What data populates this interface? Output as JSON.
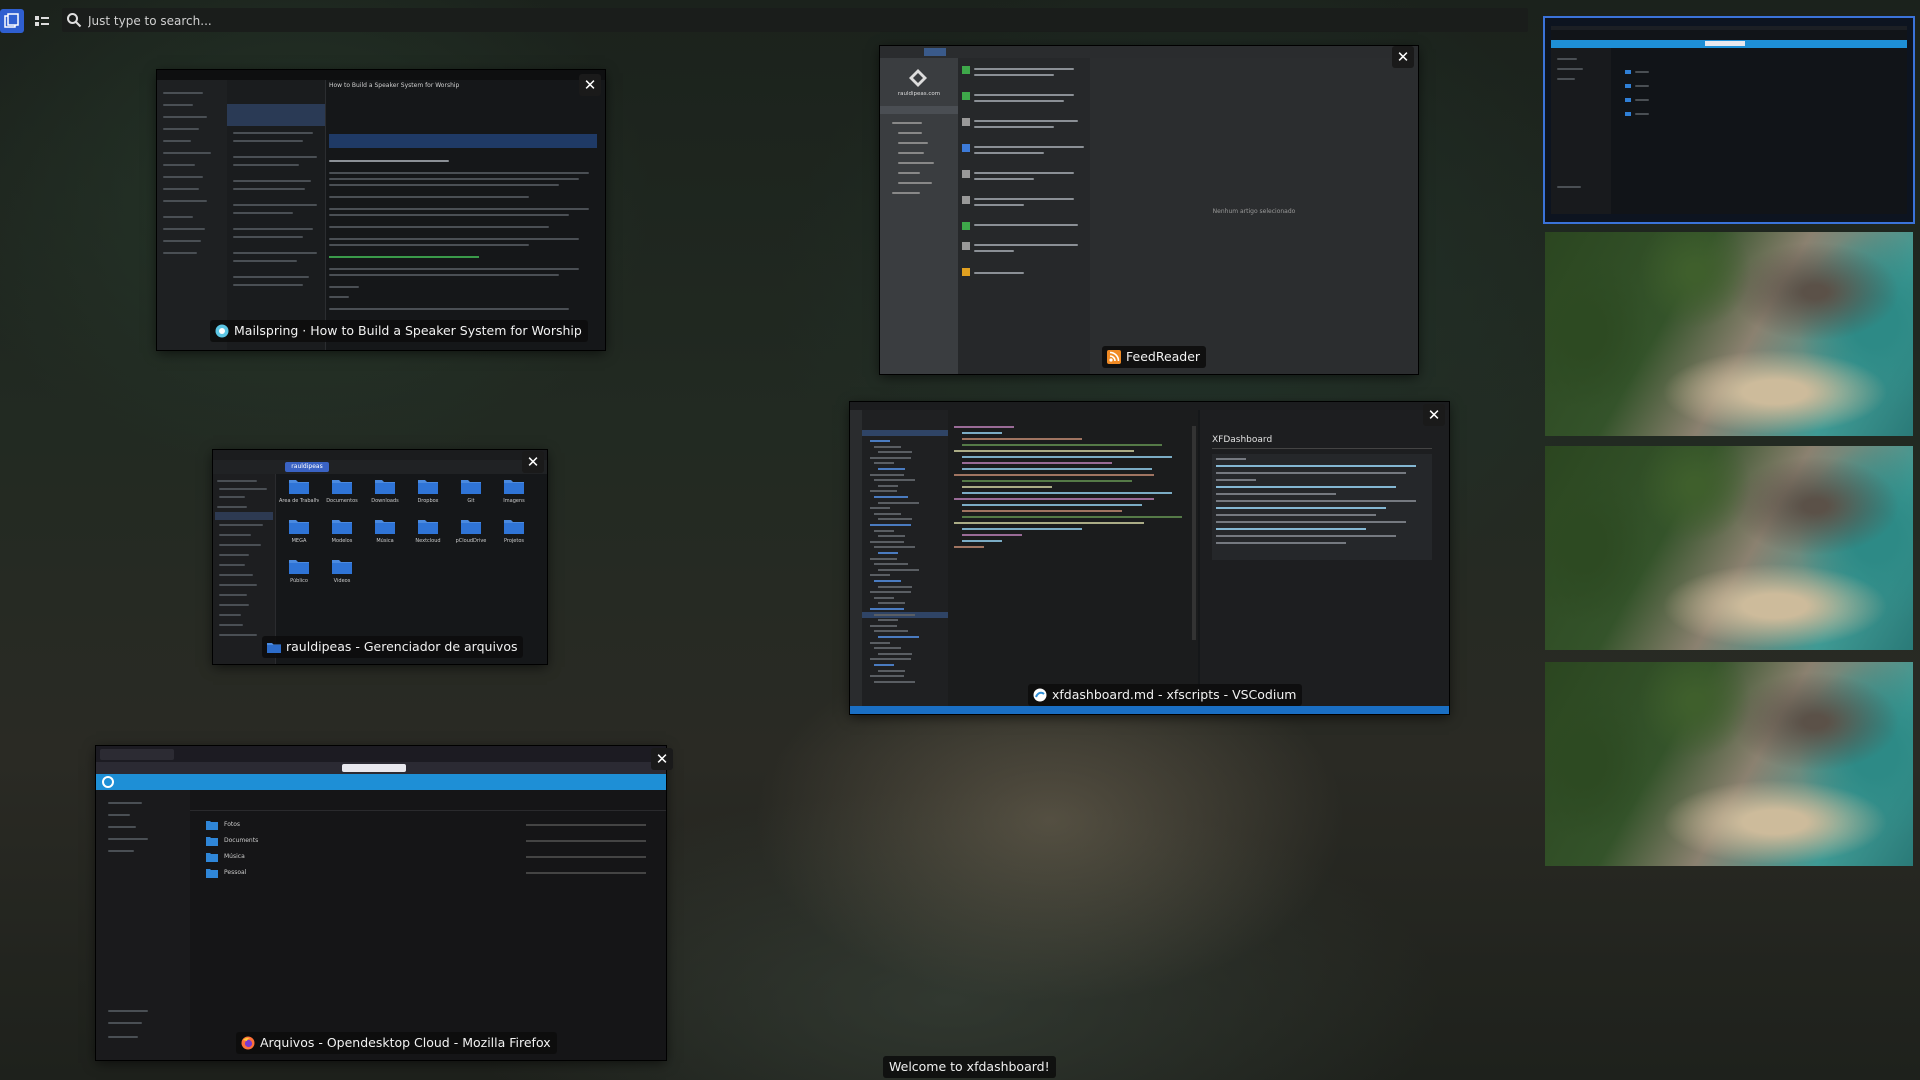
{
  "search": {
    "placeholder": "Just type to search..."
  },
  "windows": [
    {
      "title": "Mailspring · How to Build a Speaker System for Worship",
      "subject": "How to Build a Speaker System for Worship"
    },
    {
      "title": "FeedReader",
      "sidebar_title": "rauldipeas.com",
      "empty_text": "Nenhum artigo selecionado"
    },
    {
      "title": "rauldipeas - Gerenciador de arquivos",
      "path": "rauldipeas",
      "folders": [
        "Área de Trabalho",
        "Documentos",
        "Downloads",
        "Dropbox",
        "Git",
        "Imagens",
        "MEGA",
        "Modelos",
        "Música",
        "Nextcloud",
        "pCloudDrive",
        "Projetos",
        "Público",
        "Vídeos"
      ]
    },
    {
      "title": "xfdashboard.md - xfscripts - VSCodium",
      "preview_title": "XFDashboard"
    },
    {
      "title": "Arquivos - Opendesktop Cloud - Mozilla Firefox",
      "rows": [
        "Fotos",
        "Documents",
        "Música",
        "Pessoal"
      ]
    }
  ],
  "welcome": "Welcome to xfdashboard!",
  "workspaces": [
    {
      "name": "workspace-1",
      "active": true
    },
    {
      "name": "workspace-2",
      "active": false
    },
    {
      "name": "workspace-3",
      "active": false
    },
    {
      "name": "workspace-4",
      "active": false
    }
  ],
  "colors": {
    "accent": "#2f5fd0",
    "firefox_blue": "#1e8fd6",
    "vscode_status": "#1a6fc4"
  }
}
